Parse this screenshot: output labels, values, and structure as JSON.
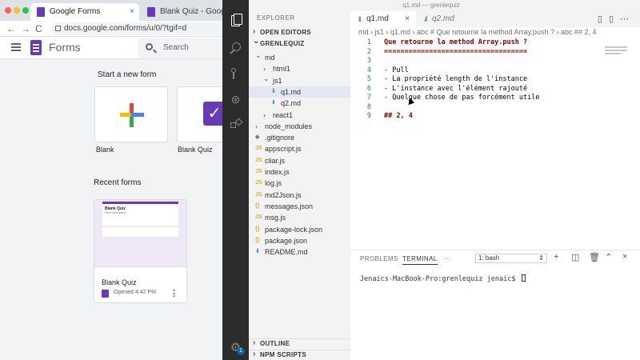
{
  "chrome": {
    "tabs": [
      {
        "label": "Google Forms",
        "close": "×"
      },
      {
        "label": "Blank Quiz - Google Form",
        "close": "×"
      }
    ],
    "nav": {
      "back": "←",
      "forward": "→",
      "reload": "C"
    },
    "url": "docs.google.com/forms/u/0/?tgif=d"
  },
  "forms": {
    "app_title": "Forms",
    "search_placeholder": "Search",
    "start_title": "Start a new form",
    "templates": [
      {
        "label": "Blank"
      },
      {
        "label": "Blank Quiz"
      }
    ],
    "recent_title": "Recent forms",
    "recent": [
      {
        "name": "Blank Quiz",
        "meta": "Opened 4:42 PM",
        "thumb_title": "Blank Quiz",
        "thumb_desc": "Form description"
      }
    ]
  },
  "vscode": {
    "window_title": "q1.md — grenlequiz",
    "explorer_title": "EXPLORER",
    "sections": {
      "open_editors": "OPEN EDITORS",
      "project": "GRENLEQUIZ",
      "outline": "OUTLINE",
      "npm_scripts": "NPM SCRIPTS"
    },
    "tree": [
      {
        "name": "md",
        "type": "folder-open",
        "depth": 1
      },
      {
        "name": "html1",
        "type": "folder",
        "depth": 2
      },
      {
        "name": "js1",
        "type": "folder-open",
        "depth": 2
      },
      {
        "name": "q1.md",
        "type": "md",
        "depth": 3,
        "selected": true
      },
      {
        "name": "q2.md",
        "type": "md",
        "depth": 3
      },
      {
        "name": "react1",
        "type": "folder",
        "depth": 2
      },
      {
        "name": "node_modules",
        "type": "folder",
        "depth": 1
      },
      {
        "name": ".gitignore",
        "type": "misc",
        "depth": 1
      },
      {
        "name": "appscript.js",
        "type": "js",
        "depth": 1
      },
      {
        "name": "cliar.js",
        "type": "js",
        "depth": 1
      },
      {
        "name": "index.js",
        "type": "js",
        "depth": 1
      },
      {
        "name": "log.js",
        "type": "js",
        "depth": 1
      },
      {
        "name": "md2Json.js",
        "type": "js",
        "depth": 1
      },
      {
        "name": "messages.json",
        "type": "json",
        "depth": 1
      },
      {
        "name": "msg.js",
        "type": "js",
        "depth": 1
      },
      {
        "name": "package-lock.json",
        "type": "json",
        "depth": 1
      },
      {
        "name": "package.json",
        "type": "json",
        "depth": 1
      },
      {
        "name": "README.md",
        "type": "md",
        "depth": 1
      }
    ],
    "editor_tabs": [
      {
        "label": "q1.md",
        "active": true
      },
      {
        "label": "q2.md",
        "active": false
      }
    ],
    "breadcrumbs": "md  ›  js1  ›  q1.md  ›  abc # Que retourne la method Array.push ?  ›  abc ## 2, 4",
    "code_lines": [
      {
        "n": "1",
        "text": "Que retourne la method Array.push ?",
        "kind": "heading"
      },
      {
        "n": "2",
        "text": "===================================",
        "kind": "rule"
      },
      {
        "n": "3",
        "text": "",
        "kind": "text"
      },
      {
        "n": "4",
        "text": "- Pull",
        "kind": "text"
      },
      {
        "n": "5",
        "text": "- La propriété length de l'instance",
        "kind": "text"
      },
      {
        "n": "6",
        "text": "- L'instance avec l'élément rajouté",
        "kind": "text"
      },
      {
        "n": "7",
        "text": "- Quelque chose de pas forcément utile",
        "kind": "text"
      },
      {
        "n": "8",
        "text": "",
        "kind": "text"
      },
      {
        "n": "9",
        "text": "## 2, 4",
        "kind": "heading"
      }
    ],
    "panel": {
      "tabs": [
        "PROBLEMS",
        "TERMINAL"
      ],
      "more": "···",
      "terminal_select": "1: bash",
      "prompt": "Jenaics-MacBook-Pro:grenlequiz jenaic$ "
    },
    "badge_count": "1",
    "colors": {
      "accent": "#0e639c",
      "activitybar": "#2c2c2c",
      "forms_purple": "#673ab7"
    }
  }
}
